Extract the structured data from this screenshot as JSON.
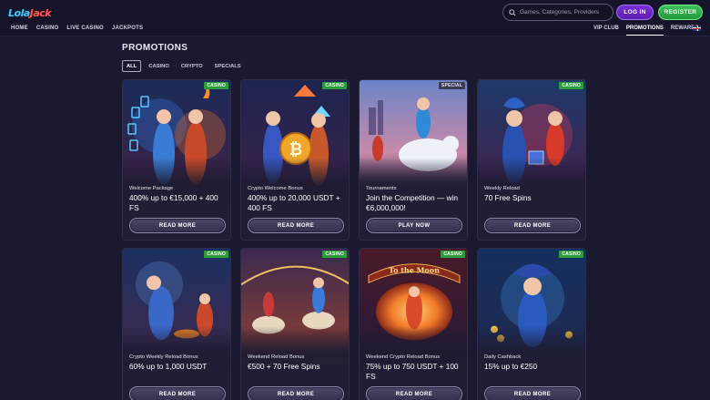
{
  "logo": {
    "part1": "Lola",
    "part2": "Jack"
  },
  "nav": {
    "main": [
      "HOME",
      "CASINO",
      "LIVE CASINO",
      "JACKPOTS"
    ],
    "right": [
      "VIP CLUB",
      "PROMOTIONS",
      "REWARDS"
    ],
    "active": "PROMOTIONS",
    "language_flag": "uk-flag-icon"
  },
  "search": {
    "placeholder": "Games, Categories, Providers",
    "icon": "search-icon"
  },
  "auth": {
    "login": "LOG IN",
    "register": "REGISTER"
  },
  "colors": {
    "login": "#6a27c4",
    "register": "#2fb04a",
    "badge_casino": "#2d9c3b",
    "background": "#1a1930"
  },
  "page": {
    "title": "PROMOTIONS",
    "filters": [
      "ALL",
      "CASINO",
      "CRYPTO",
      "SPECIALS"
    ],
    "active_filter": "ALL"
  },
  "promos": [
    {
      "badge": "CASINO",
      "small": "Welcome Package",
      "offer": "400% up to €15,000 + 400 FS",
      "button": "READ MORE"
    },
    {
      "badge": "CASINO",
      "small": "Crypto Welcome Bonus",
      "offer": "400% up to 20,000 USDT + 400 FS",
      "button": "READ MORE"
    },
    {
      "badge": "SPECIAL",
      "small": "Tournaments",
      "offer": "Join the Competition — win €6,000,000!",
      "button": "PLAY NOW"
    },
    {
      "badge": "CASINO",
      "small": "Weekly Reload",
      "offer": "70 Free Spins",
      "button": "READ MORE"
    },
    {
      "badge": "CASINO",
      "small": "Crypto Weekly Reload Bonus",
      "offer": "60% up to 1,000 USDT",
      "button": "READ MORE"
    },
    {
      "badge": "CASINO",
      "small": "Weekend Reload Bonus",
      "offer": "€500 + 70 Free Spins",
      "button": "READ MORE"
    },
    {
      "badge": "CASINO",
      "small": "Weekend Crypto Reload Bonus",
      "offer": "75% up to 750 USDT + 100 FS",
      "button": "READ MORE",
      "art_text": "To the Moon"
    },
    {
      "badge": "CASINO",
      "small": "Daily Cashback",
      "offer": "15% up to €250",
      "button": "READ MORE"
    }
  ]
}
